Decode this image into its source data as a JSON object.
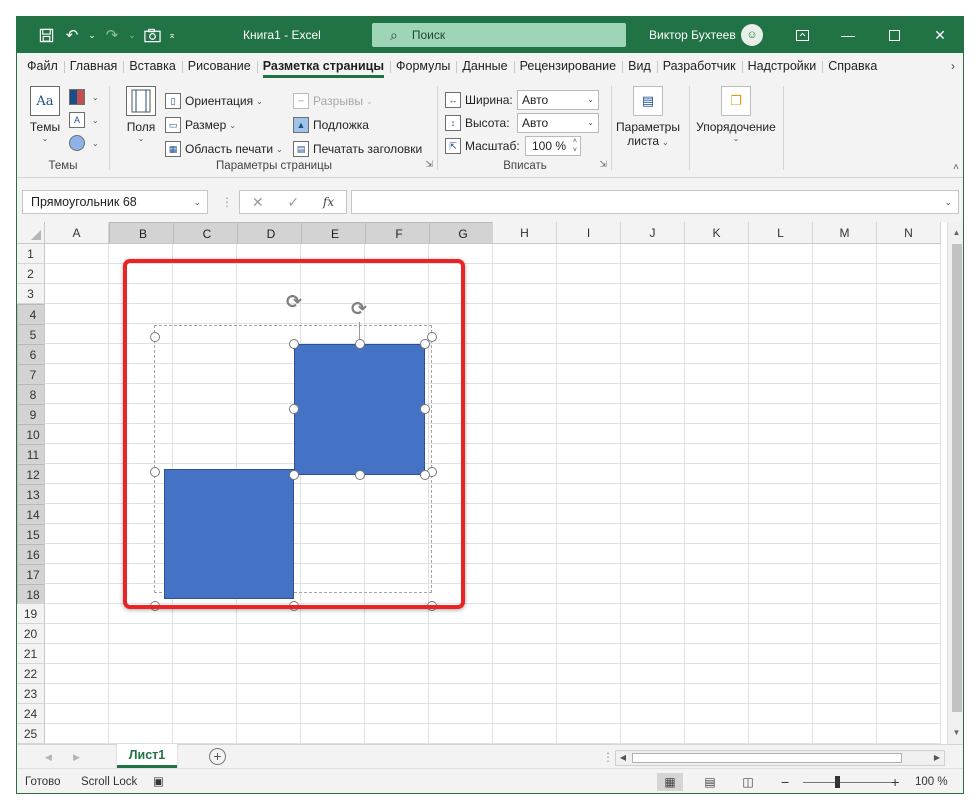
{
  "titlebar": {
    "doc_title": "Книга1  -  Excel",
    "search_placeholder": "Поиск",
    "user_name": "Виктор Бухтеев"
  },
  "tabs": [
    "Файл",
    "Главная",
    "Вставка",
    "Рисование",
    "Разметка страницы",
    "Формулы",
    "Данные",
    "Рецензирование",
    "Вид",
    "Разработчик",
    "Надстройки",
    "Справка"
  ],
  "active_tab": "Разметка страницы",
  "ribbon": {
    "themes": {
      "button_label": "Темы",
      "group_label": "Темы"
    },
    "page_setup": {
      "margins_label": "Поля",
      "orientation_label": "Ориентация",
      "size_label": "Размер",
      "print_area_label": "Область печати",
      "breaks_label": "Разрывы",
      "background_label": "Подложка",
      "print_titles_label": "Печатать заголовки",
      "group_label": "Параметры страницы"
    },
    "scale_to_fit": {
      "width_label": "Ширина:",
      "width_value": "Авто",
      "height_label": "Высота:",
      "height_value": "Авто",
      "scale_label": "Масштаб:",
      "scale_value": "100 %",
      "group_label": "Вписать"
    },
    "sheet_options": {
      "label_line1": "Параметры",
      "label_line2": "листа"
    },
    "arrange": {
      "label": "Упорядочение"
    }
  },
  "formula_bar": {
    "name_box": "Прямоугольник 68",
    "fx_label": "fx",
    "formula_value": ""
  },
  "grid": {
    "columns": [
      "A",
      "B",
      "C",
      "D",
      "E",
      "F",
      "G",
      "H",
      "I",
      "J",
      "K",
      "L",
      "M",
      "N"
    ],
    "selected_columns": [
      "B",
      "C",
      "D",
      "E",
      "F",
      "G"
    ],
    "rows": [
      "1",
      "2",
      "3",
      "4",
      "5",
      "6",
      "7",
      "8",
      "9",
      "10",
      "11",
      "12",
      "13",
      "14",
      "15",
      "16",
      "17",
      "18",
      "19",
      "20",
      "21",
      "22",
      "23",
      "24",
      "25"
    ],
    "selected_rows_range": [
      4,
      18
    ]
  },
  "sheets": {
    "active": "Лист1"
  },
  "status": {
    "ready": "Готово",
    "scroll_lock": "Scroll Lock",
    "zoom_value": "100 %"
  },
  "colors": {
    "excel_green": "#217346",
    "shape_fill": "#4472c4",
    "highlight_frame": "#ea2424"
  }
}
